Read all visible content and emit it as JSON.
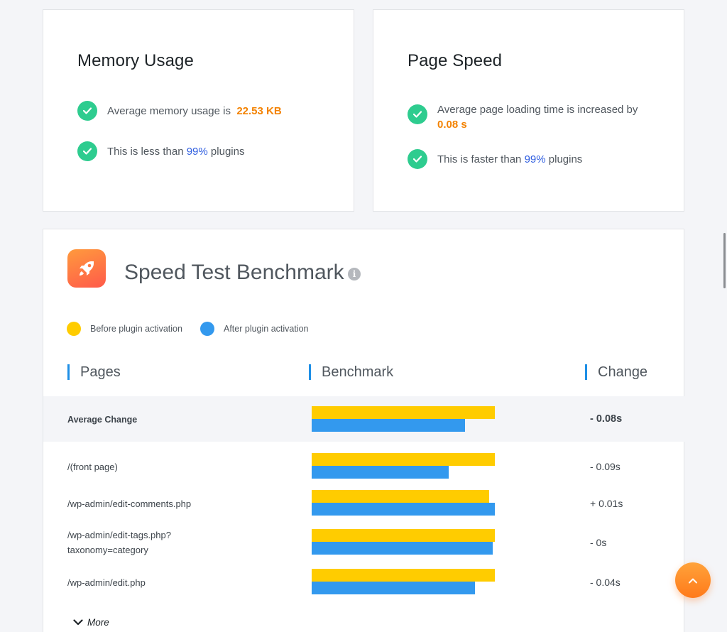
{
  "memory": {
    "title": "Memory Usage",
    "avg_prefix": "Average memory usage is",
    "avg_value": "22.53 KB",
    "less_prefix": "This is less than",
    "less_value": "99%",
    "less_suffix": "plugins"
  },
  "speed": {
    "title": "Page Speed",
    "avg_prefix": "Average page loading time is increased by",
    "avg_value": "0.08 s",
    "faster_prefix": "This is faster than",
    "faster_value": "99%",
    "faster_suffix": "plugins"
  },
  "benchmark": {
    "title": "Speed Test Benchmark",
    "info_glyph": "i",
    "legend": {
      "before": "Before plugin activation",
      "after": "After plugin activation"
    },
    "columns": {
      "pages": "Pages",
      "benchmark": "Benchmark",
      "change": "Change"
    },
    "average": {
      "label": "Average Change",
      "change": "- 0.08s",
      "before": 1.0,
      "after": 0.836
    },
    "rows": [
      {
        "label_line1": "/(front page)",
        "label_line2": "",
        "change": "- 0.09s",
        "before": 1.0,
        "after": 0.748
      },
      {
        "label_line1": "/wp-admin/edit-comments.php",
        "label_line2": "",
        "change": "+ 0.01s",
        "before": 0.969,
        "after": 1.0
      },
      {
        "label_line1": "/wp-admin/edit-tags.php?",
        "label_line2": "taxonomy=category",
        "change": "- 0s",
        "before": 1.0,
        "after": 0.988
      },
      {
        "label_line1": "/wp-admin/edit.php",
        "label_line2": "",
        "change": "- 0.04s",
        "before": 1.0,
        "after": 0.89
      }
    ],
    "more_label": "More"
  },
  "colors": {
    "check": "#2ecc8f",
    "highlight_orange": "#f38200",
    "highlight_blue": "#2f5ee0",
    "bar_before": "#ffcc00",
    "bar_after": "#3399ee",
    "accent": "#1e8fe6"
  },
  "icons": {
    "check": "check-icon",
    "rocket": "rocket-icon",
    "info": "info-icon",
    "more": "chevron-down-icon",
    "scroll_top": "chevron-up-icon"
  }
}
